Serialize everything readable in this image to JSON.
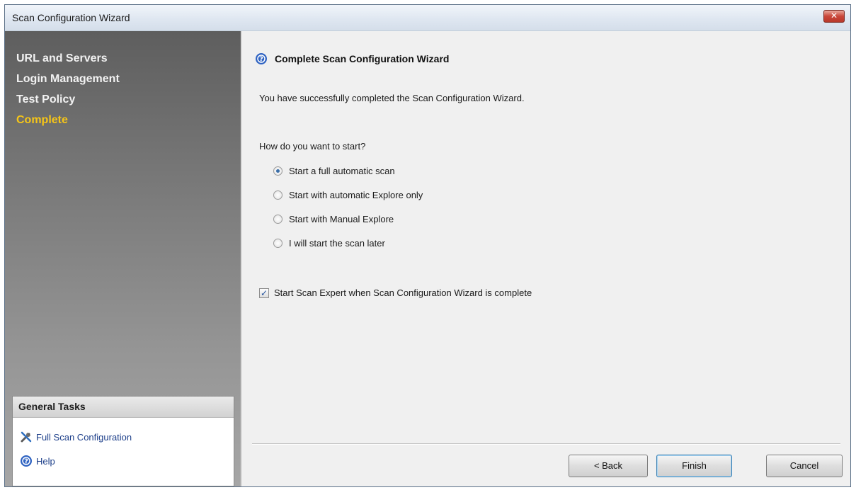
{
  "window": {
    "title": "Scan Configuration Wizard",
    "close_label": "✕"
  },
  "sidebar": {
    "steps": [
      {
        "label": "URL and Servers",
        "active": false
      },
      {
        "label": "Login Management",
        "active": false
      },
      {
        "label": "Test Policy",
        "active": false
      },
      {
        "label": "Complete",
        "active": true
      }
    ],
    "active_color": "#f5c518",
    "general_tasks": {
      "title": "General Tasks",
      "items": [
        {
          "label": "Full Scan Configuration",
          "icon": "tools-icon"
        },
        {
          "label": "Help",
          "icon": "help-icon"
        }
      ]
    }
  },
  "main": {
    "heading": "Complete Scan Configuration Wizard",
    "message": "You have successfully completed the Scan Configuration Wizard.",
    "question": "How do you want to start?",
    "options": [
      {
        "label": "Start a full automatic scan",
        "selected": true
      },
      {
        "label": "Start with automatic Explore only",
        "selected": false
      },
      {
        "label": "Start with Manual Explore",
        "selected": false
      },
      {
        "label": "I will start the scan later",
        "selected": false
      }
    ],
    "checkbox": {
      "label": "Start Scan Expert when Scan Configuration Wizard is complete",
      "checked": true
    }
  },
  "buttons": {
    "back": "< Back",
    "finish": "Finish",
    "cancel": "Cancel"
  }
}
